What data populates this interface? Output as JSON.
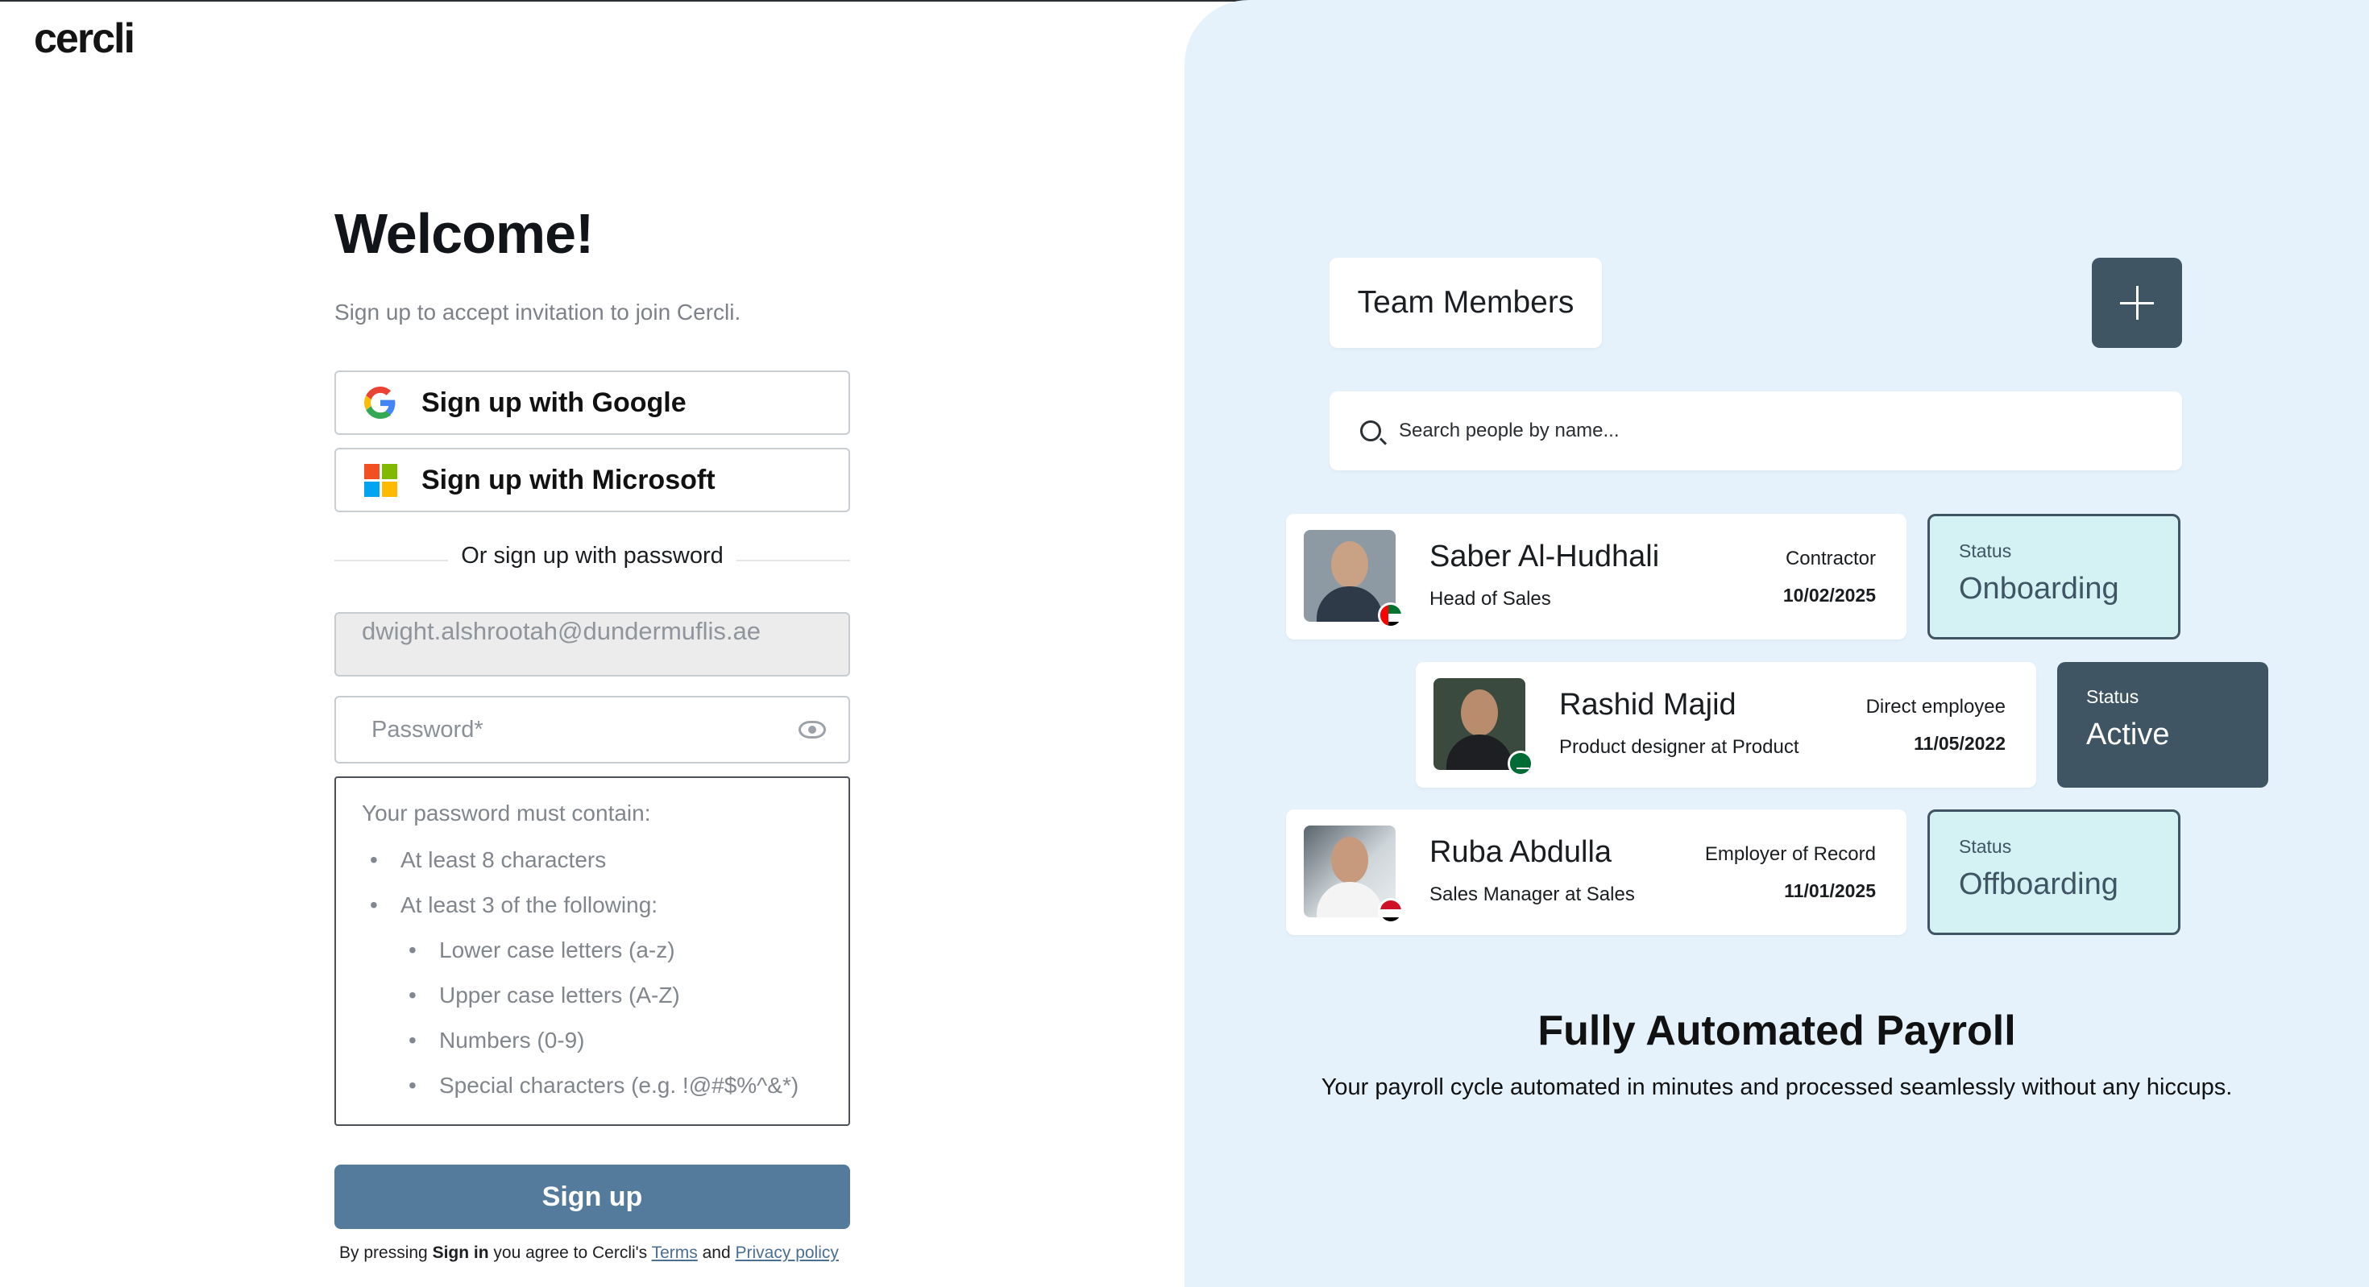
{
  "brand": {
    "logo": "cercli"
  },
  "signup": {
    "title": "Welcome!",
    "subtitle": "Sign up to accept invitation to join Cercli.",
    "google_label": "Sign up with Google",
    "microsoft_label": "Sign up with Microsoft",
    "divider": "Or sign up with password",
    "email_value": "dwight.alshrootah@dundermuflis.ae",
    "password_placeholder": "Password*",
    "rules": {
      "heading": "Your password must contain:",
      "r1": "At least 8 characters",
      "r2": "At least 3 of the following:",
      "r2a": "Lower case letters (a-z)",
      "r2b": "Upper case letters (A-Z)",
      "r2c": "Numbers (0-9)",
      "r2d": "Special characters (e.g. !@#$%^&*)"
    },
    "submit_label": "Sign up",
    "legal": {
      "prefix": "By pressing ",
      "bold": "Sign in",
      "middle": " you agree to Cercli's ",
      "terms": "Terms",
      "and": " and ",
      "privacy": "Privacy policy"
    }
  },
  "showcase": {
    "team_title": "Team Members",
    "search_placeholder": "Search people by name...",
    "members": [
      {
        "name": "Saber Al-Hudhali",
        "role": "Head of Sales",
        "type": "Contractor",
        "date": "10/02/2025",
        "status_label": "Status",
        "status": "Onboarding"
      },
      {
        "name": "Rashid Majid",
        "role": "Product designer at Product",
        "type": "Direct employee",
        "date": "11/05/2022",
        "status_label": "Status",
        "status": "Active"
      },
      {
        "name": "Ruba Abdulla",
        "role": "Sales Manager at Sales",
        "type": "Employer of Record",
        "date": "11/01/2025",
        "status_label": "Status",
        "status": "Offboarding"
      }
    ],
    "promo_title": "Fully Automated Payroll",
    "promo_subtitle": "Your payroll cycle automated in minutes and processed seamlessly without any hiccups."
  },
  "colors": {
    "primary_button": "#547a9c",
    "panel_bg": "#e5f2fb",
    "status_dark": "#3f5563",
    "status_light": "#d4f1f4"
  }
}
